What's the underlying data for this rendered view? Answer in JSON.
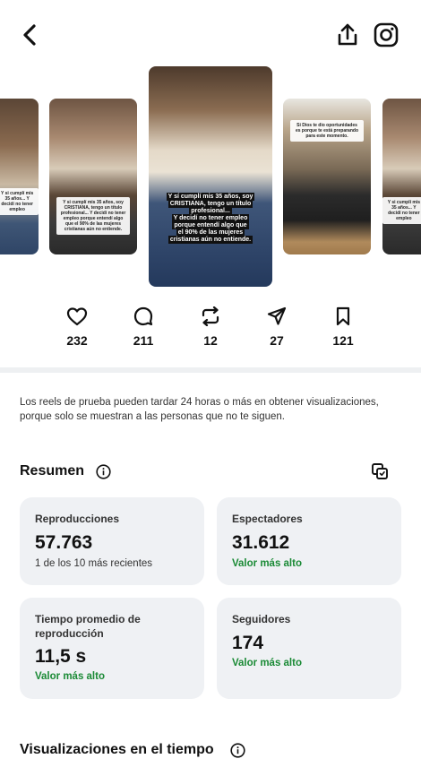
{
  "header": {
    "back_icon": "chevron-left-icon",
    "share_icon": "share-upload-icon",
    "instagram_icon": "instagram-icon"
  },
  "carousel": {
    "thumbs": [
      {
        "name": "reel-thumb-far-left"
      },
      {
        "name": "reel-thumb-left",
        "overlay": "Y si cumplí mis 35 años, soy CRISTIANA, tengo un título profesional... Y decidí no tener empleo porque entendí algo que el 90% de las mujeres cristianas aún no entiende."
      },
      {
        "name": "reel-thumb-main",
        "overlay_lines": [
          "Y sí cumplí mis 35 años, soy",
          "CRISTIANA, tengo un título",
          "profesional...",
          "Y decidí no tener empleo",
          "porque entendí algo que",
          "el 90% de las mujeres",
          "cristianas aún no entiende."
        ]
      },
      {
        "name": "reel-thumb-right",
        "overlay": "Si Dios te dio oportunidades es porque te está preparando para este momento."
      },
      {
        "name": "reel-thumb-far-right",
        "overlay": "Y si cumplí mis 35 años... Y decidí no tener empleo"
      }
    ]
  },
  "stats": {
    "likes": {
      "icon": "heart-icon",
      "value": "232"
    },
    "comments": {
      "icon": "comment-icon",
      "value": "211"
    },
    "reposts": {
      "icon": "repost-icon",
      "value": "12"
    },
    "shares": {
      "icon": "send-icon",
      "value": "27"
    },
    "saves": {
      "icon": "bookmark-icon",
      "value": "121"
    }
  },
  "note": "Los reels de prueba pueden tardar 24 horas o más en obtener visualizaciones, porque solo se muestran a las personas que no te siguen.",
  "summary": {
    "title": "Resumen",
    "info_icon": "info-icon",
    "compare_icon": "compare-icon",
    "cards": {
      "reproducciones": {
        "label": "Reproducciones",
        "value": "57.763",
        "sub": "1 de los 10 más recientes"
      },
      "espectadores": {
        "label": "Espectadores",
        "value": "31.612",
        "sub": "Valor más alto"
      },
      "tiempo": {
        "label": "Tiempo promedio de reproducción",
        "value": "11,5 s",
        "sub": "Valor más alto"
      },
      "seguidores": {
        "label": "Seguidores",
        "value": "174",
        "sub": "Valor más alto"
      }
    }
  },
  "timeline": {
    "title": "Visualizaciones en el tiempo",
    "info_icon": "info-icon"
  },
  "colors": {
    "card_bg": "#eff1f4",
    "highlight_green": "#1a8a35",
    "divider": "#eef0f2"
  }
}
